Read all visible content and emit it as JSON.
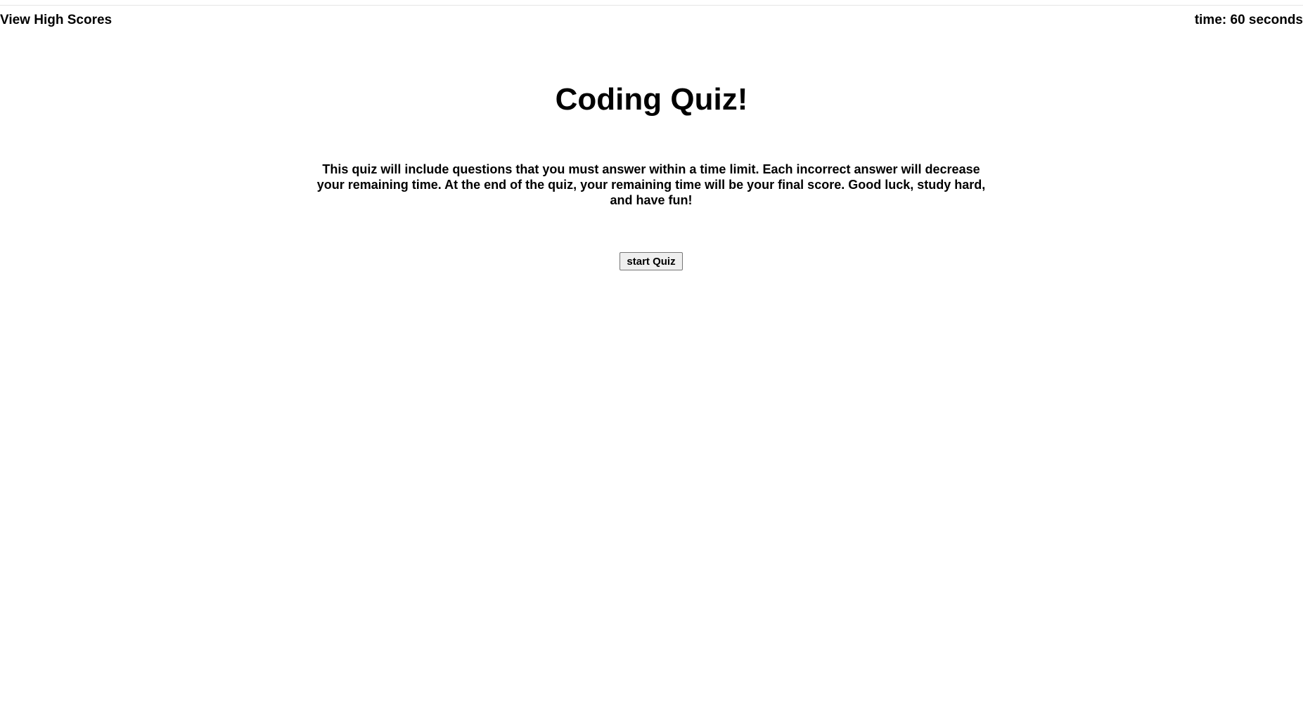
{
  "header": {
    "high_scores_label": "View High Scores",
    "timer_text": "time: 60 seconds"
  },
  "main": {
    "title": "Coding Quiz!",
    "intro": "This quiz will include questions that you must answer within a time limit. Each incorrect answer will decrease your remaining time. At the end of the quiz, your remaining time will be your final score. Good luck, study hard, and have fun!",
    "start_button_label": "start Quiz"
  },
  "colors": {
    "background": "#ffffff",
    "text": "#000000",
    "button_background": "#efefef",
    "button_border": "#767676"
  }
}
